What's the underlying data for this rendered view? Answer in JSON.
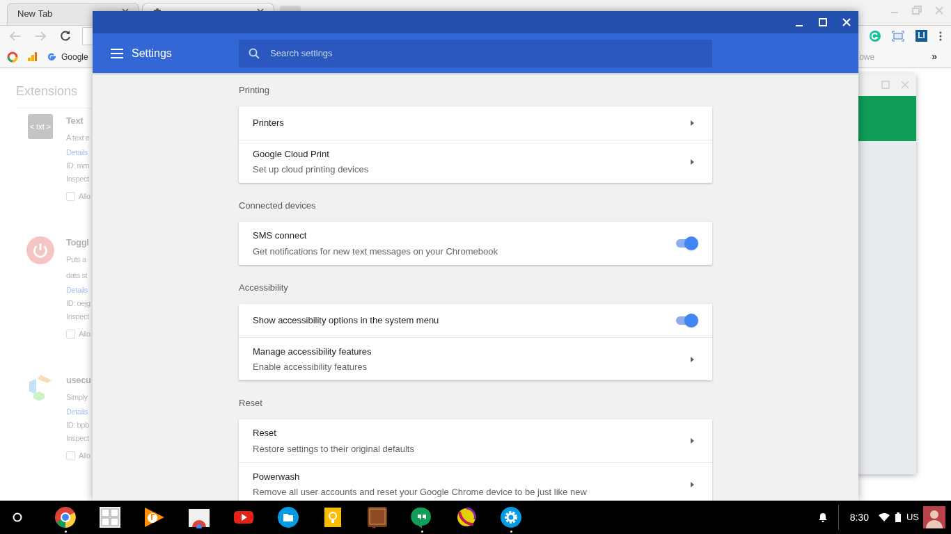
{
  "browser": {
    "tabs": [
      {
        "label": "New Tab",
        "selected": false
      },
      {
        "selected": true
      }
    ],
    "bookmarks": [
      {
        "kind": "rings"
      },
      {
        "kind": "bars"
      },
      {
        "kind": "g",
        "label": "Google"
      }
    ],
    "bookmark_right": "owe",
    "bookmark_overflow": "»",
    "extension_buttons": [
      {
        "kind": "grammar"
      },
      {
        "kind": "screen"
      },
      {
        "kind": "li",
        "label": "LI"
      }
    ]
  },
  "extensions_page": {
    "title": "Extensions",
    "items": [
      {
        "kind": "txt",
        "icon_label": "< txt >",
        "name": "Text",
        "description": [
          "A text e"
        ],
        "details": "Details",
        "id": "ID: mm",
        "inspect": "Inspect",
        "allow": "Allo",
        "checked": false
      },
      {
        "kind": "power",
        "name": "Toggl",
        "description": [
          "Puts a",
          "data st"
        ],
        "details": "Details",
        "id": "ID: oejg",
        "inspect": "Inspect",
        "allow": "Allo",
        "checked": false
      },
      {
        "kind": "blocks",
        "name": "usecu",
        "description": [
          "Simply"
        ],
        "details": "Details",
        "id": "ID: bpb",
        "inspect": "Inspect",
        "allow": "Allo",
        "checked": false
      }
    ]
  },
  "settings_window": {
    "title": "Settings",
    "search": {
      "placeholder": "Search settings"
    },
    "sections": [
      {
        "heading": "Printing",
        "rows": [
          {
            "kind": "link",
            "title": "Printers"
          },
          {
            "kind": "link",
            "title": "Google Cloud Print",
            "subtitle": "Set up cloud printing devices"
          }
        ]
      },
      {
        "heading": "Connected devices",
        "rows": [
          {
            "kind": "toggle",
            "title": "SMS connect",
            "subtitle": "Get notifications for new text messages on your Chromebook",
            "on": true
          }
        ]
      },
      {
        "heading": "Accessibility",
        "rows": [
          {
            "kind": "toggle",
            "title": "Show accessibility options in the system menu",
            "on": true
          },
          {
            "kind": "link",
            "title": "Manage accessibility features",
            "subtitle": "Enable accessibility features"
          }
        ]
      },
      {
        "heading": "Reset",
        "rows": [
          {
            "kind": "link",
            "title": "Reset",
            "subtitle": "Restore settings to their original defaults"
          },
          {
            "kind": "link",
            "title": "Powerwash",
            "subtitle": "Remove all user accounts and reset your Google Chrome device to be just like new"
          }
        ]
      }
    ]
  },
  "taskbar": {
    "apps": [
      {
        "kind": "browser",
        "running": true
      },
      {
        "kind": "calculator",
        "running": false
      },
      {
        "kind": "music",
        "running": false
      },
      {
        "kind": "store",
        "running": false
      },
      {
        "kind": "video",
        "running": false
      },
      {
        "kind": "folder",
        "running": false
      },
      {
        "kind": "bulb",
        "running": false
      },
      {
        "kind": "book",
        "running": false
      },
      {
        "kind": "chat",
        "running": true
      },
      {
        "kind": "ball",
        "running": false
      },
      {
        "kind": "settings",
        "running": true
      }
    ],
    "time": "8:30",
    "keyboard": "US"
  }
}
